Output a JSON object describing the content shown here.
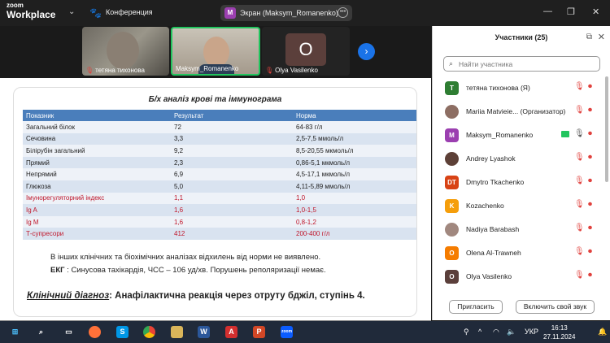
{
  "app": {
    "logo_line1": "zoom",
    "logo_line2": "Workplace",
    "conference_label": "Конференция",
    "screen_share_label": "Экран (Maksym_Romanenko)",
    "screen_share_initial": "M"
  },
  "videos": [
    {
      "name": "тетяна тихонова",
      "muted": true
    },
    {
      "name": "Maksym_Romanenko",
      "muted": false,
      "active_speaker": true
    },
    {
      "name": "Olya Vasilenko",
      "muted": true,
      "initial": "O"
    }
  ],
  "slide": {
    "title": "Б/х аналіз крові та іммунограма",
    "columns": [
      "Показник",
      "Результат",
      "Норма"
    ],
    "rows": [
      {
        "name": "Загальний білок",
        "result": "72",
        "norm": "64-83 г/л",
        "highlight": false
      },
      {
        "name": "Сечовина",
        "result": "3,3",
        "norm": "2,5-7,5 ммоль/л",
        "highlight": false
      },
      {
        "name": "Білірубін загальний",
        "result": "9,2",
        "norm": "8,5-20,55 мкмоль/л",
        "highlight": false
      },
      {
        "name": "Прямий",
        "result": "2,3",
        "norm": "0,86-5,1 мкмоль/л",
        "highlight": false
      },
      {
        "name": "Непрямий",
        "result": "6,9",
        "norm": "4,5-17,1 мкмоль/л",
        "highlight": false
      },
      {
        "name": "Глюкоза",
        "result": "5,0",
        "norm": "4,11-5,89 ммоль/л",
        "highlight": false
      },
      {
        "name": "Імунорегуляторний індекс",
        "result": "1,1",
        "norm": "1,0",
        "highlight": true
      },
      {
        "name": "Ig A",
        "result": "1,6",
        "norm": "1,0-1,5",
        "highlight": true
      },
      {
        "name": "Ig M",
        "result": "1,6",
        "norm": "0,8-1,2",
        "highlight": true
      },
      {
        "name": "Т-супресори",
        "result": "412",
        "norm": "200-400 г/л",
        "highlight": true
      }
    ],
    "note1": "В інших клінічних та біохімічних аналізах відхилень від норми не виявлено.",
    "note2_label": "ЕКГ",
    "note2_text": " : Синусова тахікардія, ЧСС – 106 уд/хв. Порушень реполяризації немає.",
    "diagnosis_label": "Клінічний діагноз",
    "diagnosis_text": ": Анафілактична реакція через отруту бджіл, ступінь 4."
  },
  "participants": {
    "title": "Участники (25)",
    "search_placeholder": "Найти участника",
    "list": [
      {
        "name": "тетяна тихонова (Я)",
        "initial": "T",
        "color": "#2e7d32",
        "photo": false
      },
      {
        "name": "Mariia Matvieie... (Организатор)",
        "initial": "",
        "color": "#8d6e63",
        "photo": true
      },
      {
        "name": "Maksym_Romanenko",
        "initial": "M",
        "color": "#9b3fb0",
        "photo": false,
        "sharing": true
      },
      {
        "name": "Andrey Lyashok",
        "initial": "",
        "color": "#5d4037",
        "photo": true
      },
      {
        "name": "Dmytro Tkachenko",
        "initial": "DT",
        "color": "#d84315",
        "photo": false
      },
      {
        "name": "Kozachenko",
        "initial": "K",
        "color": "#f59e0b",
        "photo": false
      },
      {
        "name": "Nadiya Barabash",
        "initial": "",
        "color": "#a1887f",
        "photo": true
      },
      {
        "name": "Olena Al-Trawneh",
        "initial": "O",
        "color": "#f57c00",
        "photo": false
      },
      {
        "name": "Olya Vasilenko",
        "initial": "O",
        "color": "#5b3f3b",
        "photo": false
      }
    ],
    "invite_label": "Пригласить",
    "unmute_label": "Включить свой звук"
  },
  "taskbar": {
    "language": "УКР",
    "time": "16:13",
    "date": "27.11.2024"
  }
}
